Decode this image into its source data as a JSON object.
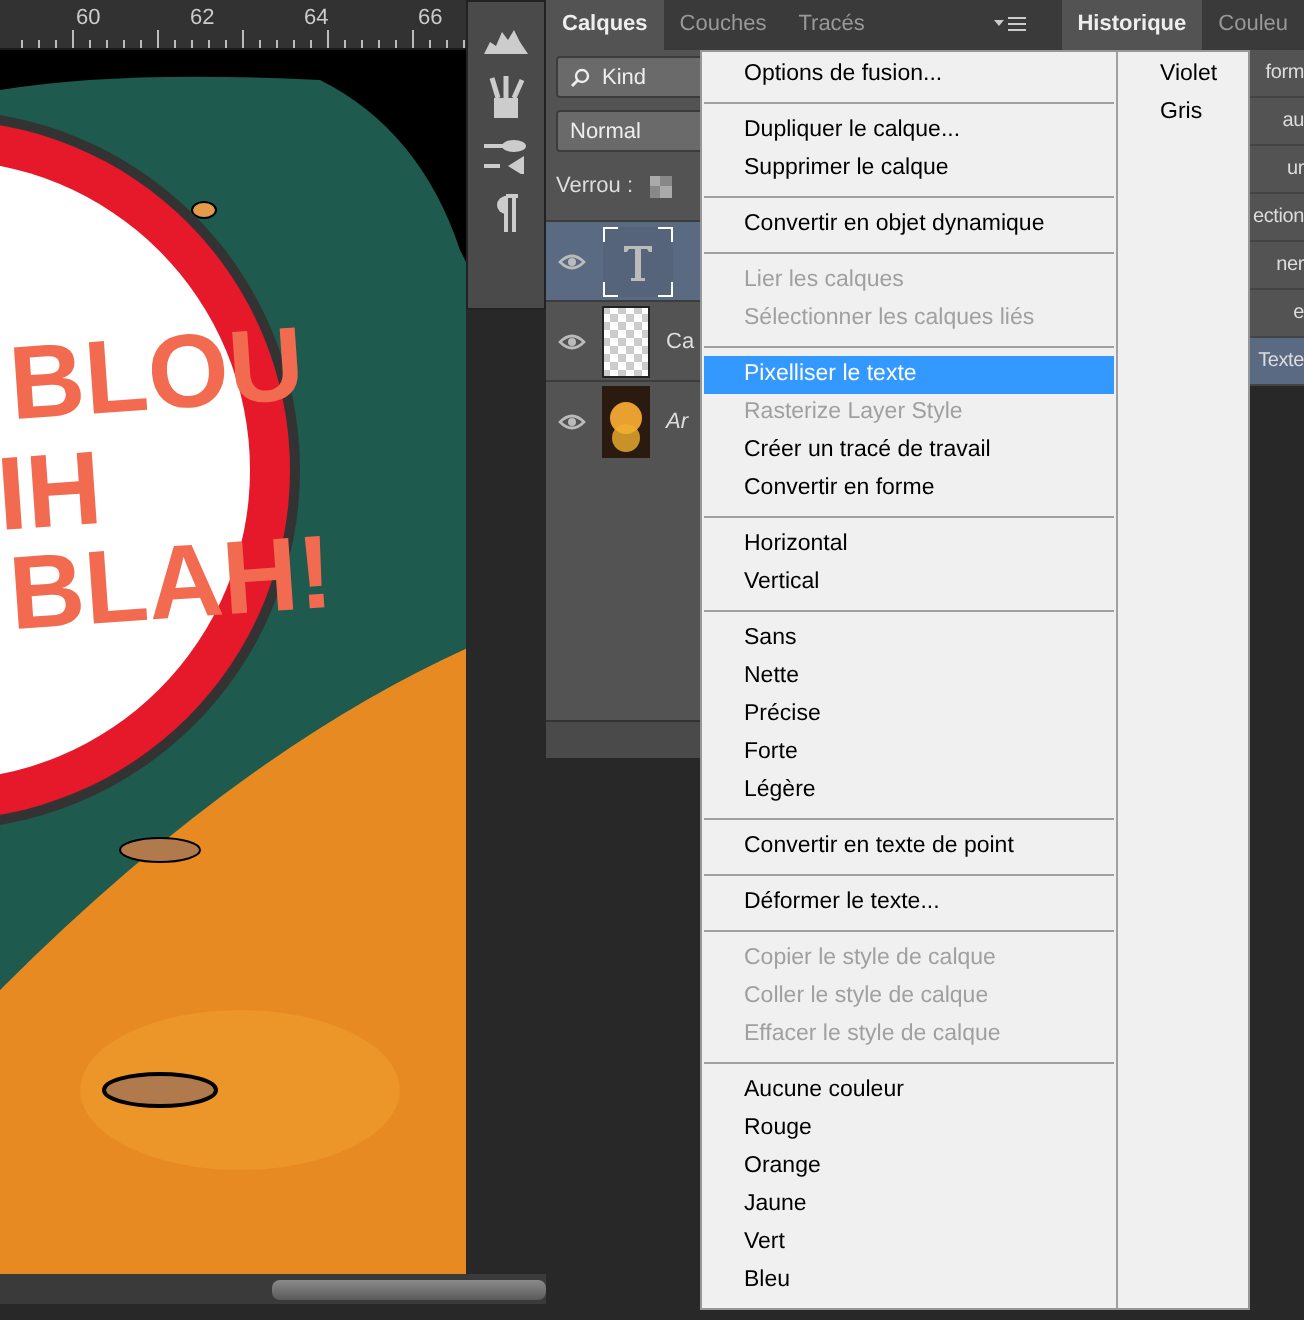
{
  "ruler": {
    "labels": [
      "60",
      "62",
      "64",
      "66"
    ]
  },
  "artwork": {
    "bubble_lines": [
      "BLOU",
      "IH",
      "BLAH!"
    ]
  },
  "layers_panel": {
    "tabs": [
      {
        "label": "Calques",
        "selected": true
      },
      {
        "label": "Couches",
        "selected": false
      },
      {
        "label": "Tracés",
        "selected": false
      }
    ],
    "filter": {
      "value": "Kind"
    },
    "blend_mode": {
      "value": "Normal"
    },
    "lock_label": "Verrou :",
    "layers": [
      {
        "kind": "text",
        "selected": true,
        "visible": true
      },
      {
        "kind": "transparent",
        "name": "Ca",
        "selected": false,
        "visible": true
      },
      {
        "kind": "artwork",
        "name": "Ar",
        "selected": false,
        "visible": true
      }
    ]
  },
  "history_panel": {
    "tabs": [
      {
        "label": "Historique",
        "selected": true
      },
      {
        "label": "Couleu",
        "selected": false
      }
    ],
    "rows": [
      {
        "label": "form",
        "selected": false
      },
      {
        "label": "au",
        "selected": false
      },
      {
        "label": "ur",
        "selected": false
      },
      {
        "label": "ection",
        "selected": false
      },
      {
        "label": "ner",
        "selected": false
      },
      {
        "label": "e",
        "selected": false
      },
      {
        "label": "Texte",
        "selected": true
      }
    ]
  },
  "context_menu": {
    "items": [
      {
        "kind": "item",
        "label": "Options de fusion...",
        "disabled": false,
        "selected": false
      },
      {
        "kind": "separator"
      },
      {
        "kind": "item",
        "label": "Dupliquer le calque...",
        "disabled": false,
        "selected": false
      },
      {
        "kind": "item",
        "label": "Supprimer le calque",
        "disabled": false,
        "selected": false
      },
      {
        "kind": "separator"
      },
      {
        "kind": "item",
        "label": "Convertir en objet dynamique",
        "disabled": false,
        "selected": false
      },
      {
        "kind": "separator"
      },
      {
        "kind": "item",
        "label": "Lier les calques",
        "disabled": true,
        "selected": false
      },
      {
        "kind": "item",
        "label": "Sélectionner les calques liés",
        "disabled": true,
        "selected": false
      },
      {
        "kind": "separator"
      },
      {
        "kind": "item",
        "label": "Pixelliser le texte",
        "disabled": false,
        "selected": true
      },
      {
        "kind": "item",
        "label": "Rasterize Layer Style",
        "disabled": true,
        "selected": false
      },
      {
        "kind": "item",
        "label": "Créer un tracé de travail",
        "disabled": false,
        "selected": false
      },
      {
        "kind": "item",
        "label": "Convertir en forme",
        "disabled": false,
        "selected": false
      },
      {
        "kind": "separator"
      },
      {
        "kind": "item",
        "label": "Horizontal",
        "disabled": false,
        "selected": false
      },
      {
        "kind": "item",
        "label": "Vertical",
        "disabled": false,
        "selected": false
      },
      {
        "kind": "separator"
      },
      {
        "kind": "item",
        "label": "Sans",
        "disabled": false,
        "selected": false
      },
      {
        "kind": "item",
        "label": "Nette",
        "disabled": false,
        "selected": false
      },
      {
        "kind": "item",
        "label": "Précise",
        "disabled": false,
        "selected": false
      },
      {
        "kind": "item",
        "label": "Forte",
        "disabled": false,
        "selected": false
      },
      {
        "kind": "item",
        "label": "Légère",
        "disabled": false,
        "selected": false
      },
      {
        "kind": "separator"
      },
      {
        "kind": "item",
        "label": "Convertir en texte de point",
        "disabled": false,
        "selected": false
      },
      {
        "kind": "separator"
      },
      {
        "kind": "item",
        "label": "Déformer le texte...",
        "disabled": false,
        "selected": false
      },
      {
        "kind": "separator"
      },
      {
        "kind": "item",
        "label": "Copier le style de calque",
        "disabled": true,
        "selected": false
      },
      {
        "kind": "item",
        "label": "Coller le style de calque",
        "disabled": true,
        "selected": false
      },
      {
        "kind": "item",
        "label": "Effacer le style de calque",
        "disabled": true,
        "selected": false
      },
      {
        "kind": "separator"
      },
      {
        "kind": "item",
        "label": "Aucune couleur",
        "disabled": false,
        "selected": false
      },
      {
        "kind": "item",
        "label": "Rouge",
        "disabled": false,
        "selected": false
      },
      {
        "kind": "item",
        "label": "Orange",
        "disabled": false,
        "selected": false
      },
      {
        "kind": "item",
        "label": "Jaune",
        "disabled": false,
        "selected": false
      },
      {
        "kind": "item",
        "label": "Vert",
        "disabled": false,
        "selected": false
      },
      {
        "kind": "item",
        "label": "Bleu",
        "disabled": false,
        "selected": false
      }
    ],
    "second_column": [
      {
        "label": "Violet",
        "disabled": false,
        "selected": false
      },
      {
        "label": "Gris",
        "disabled": false,
        "selected": false
      }
    ]
  }
}
